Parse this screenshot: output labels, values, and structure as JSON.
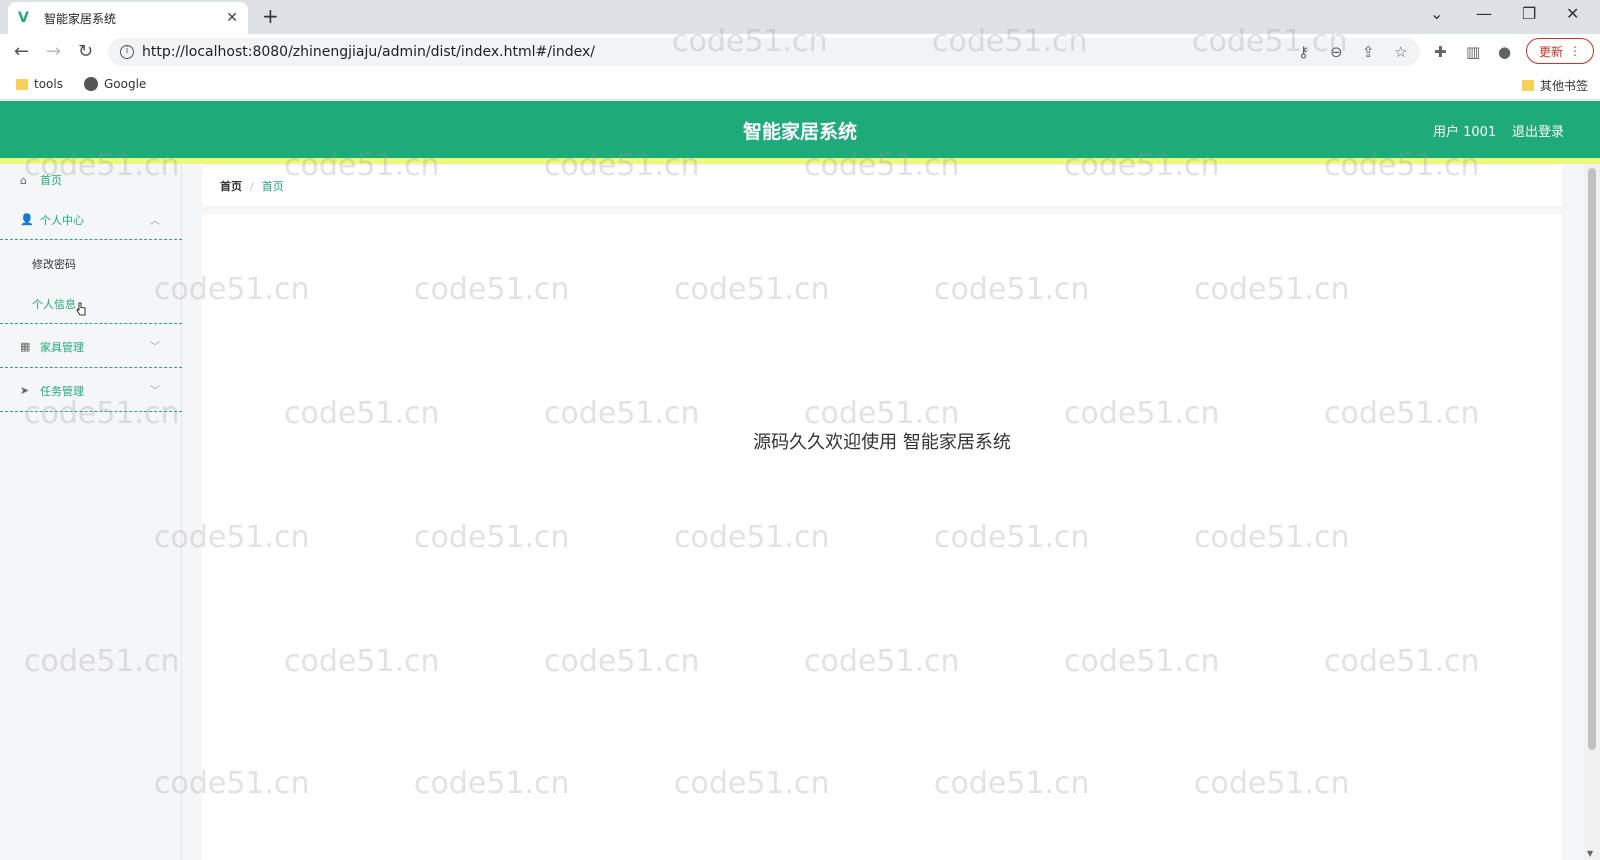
{
  "browser": {
    "tab_title": "智能家居系统",
    "url": "http://localhost:8080/zhinengjiaju/admin/dist/index.html#/index/",
    "update_label": "更新",
    "bookmarks": [
      {
        "label": "tools"
      },
      {
        "label": "Google"
      },
      {
        "label": "其他书签"
      }
    ]
  },
  "header": {
    "title": "智能家居系统",
    "user": "用户 1001",
    "logout": "退出登录",
    "colors": {
      "primary": "#1fab79",
      "stripe": "#edf97a"
    }
  },
  "sidebar": {
    "home": "首页",
    "personal_center": "个人中心",
    "personal_sub": [
      "修改密码",
      "个人信息"
    ],
    "furniture": "家具管理",
    "tasks": "任务管理"
  },
  "breadcrumb": {
    "home": "首页",
    "separator": "/",
    "current": "首页"
  },
  "main": {
    "welcome": "源码久久欢迎使用 智能家居系统"
  },
  "watermark": {
    "text": "code51.cn"
  }
}
